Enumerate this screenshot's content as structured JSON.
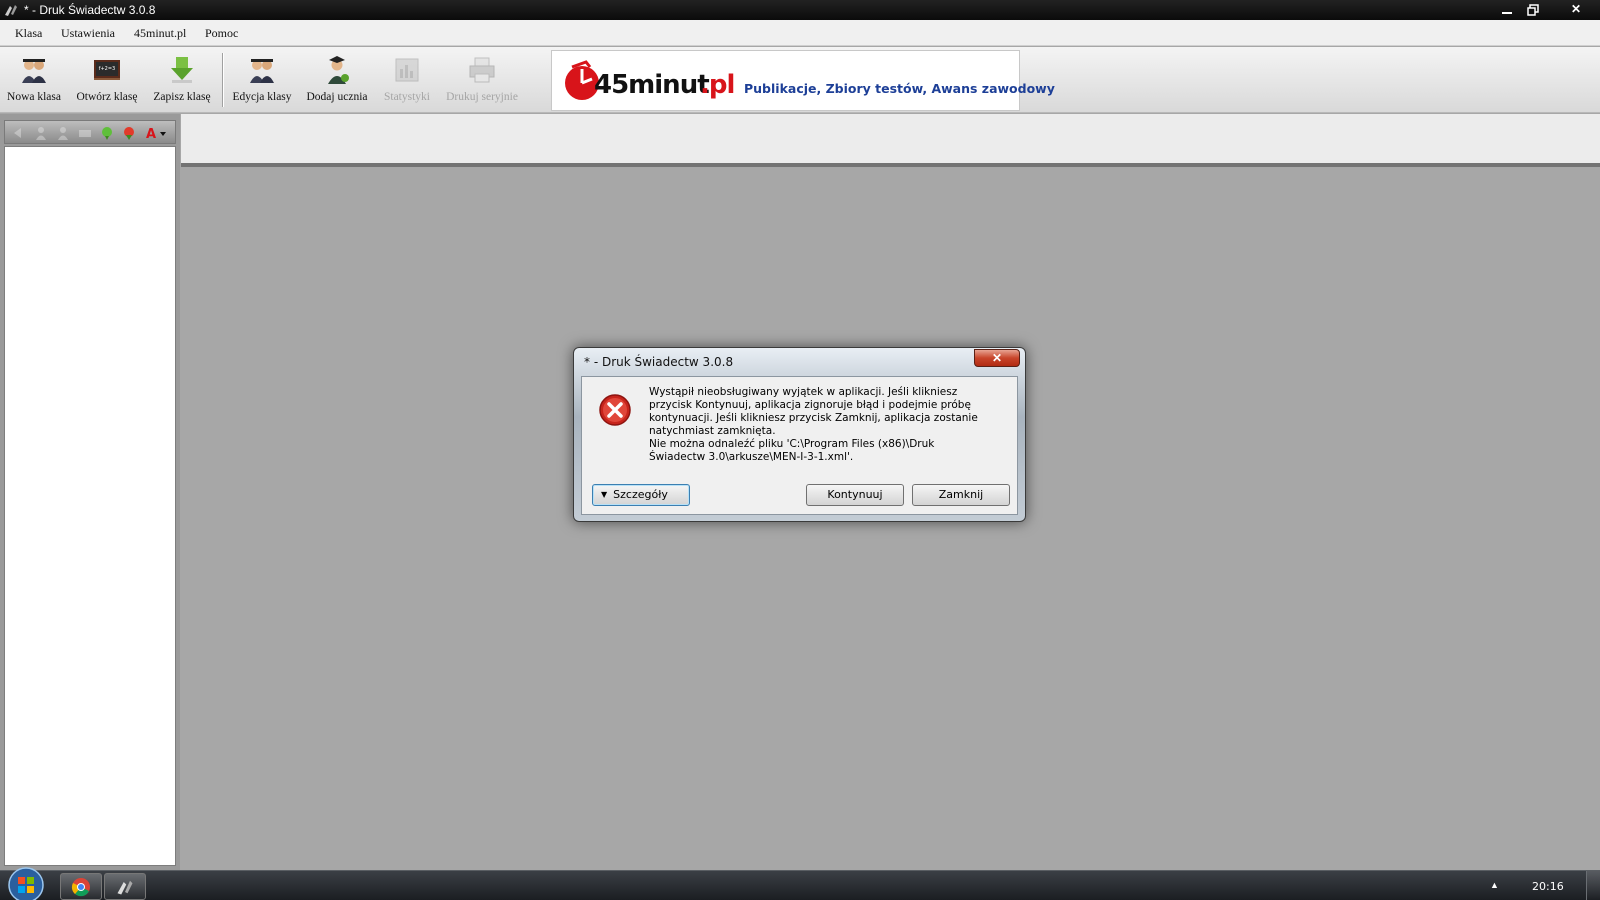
{
  "window": {
    "title": "* - Druk Świadectw 3.0.8",
    "minimize": "🗕",
    "maximize": "🗗",
    "close": "✕"
  },
  "menu": [
    "Klasa",
    "Ustawienia",
    "45minut.pl",
    "Pomoc"
  ],
  "toolbar": {
    "tools": [
      {
        "label": "Nowa klasa",
        "icon": "students-group-icon",
        "enabled": true
      },
      {
        "label": "Otwórz klasę",
        "icon": "blackboard-icon",
        "enabled": true
      },
      {
        "label": "Zapisz klasę",
        "icon": "save-arrow-icon",
        "enabled": true
      },
      {
        "label": "Edycja klasy",
        "icon": "students-edit-icon",
        "enabled": true
      },
      {
        "label": "Dodaj ucznia",
        "icon": "add-student-icon",
        "enabled": true
      },
      {
        "label": "Statystyki",
        "icon": "statistics-icon",
        "enabled": false
      },
      {
        "label": "Drukuj seryjnie",
        "icon": "printer-icon",
        "enabled": false
      }
    ]
  },
  "banner": {
    "logo_text": "45minut.pl",
    "tagline": "Publikacje, Zbiory testów, Awans zawodowy",
    "colors": {
      "logo_red": "#d8141a",
      "tagline_blue": "#1d3f97"
    }
  },
  "clock": "20:16",
  "dialog": {
    "title": "* - Druk Świadectw 3.0.8",
    "close": "✕",
    "message_line1": "Wystąpił nieobsługiwany wyjątek w aplikacji. Jeśli klikniesz przycisk Kontynuuj, aplikacja zignoruje błąd i podejmie próbę kontynuacji. Jeśli klikniesz przycisk Zamknij, aplikacja zostanie natychmiast zamknięta.",
    "message_line2": "Nie można odnaleźć pliku 'C:\\Program Files (x86)\\Druk Świadectw 3.0\\arkusze\\MEN-I-3-1.xml'.",
    "buttons": {
      "details": "Szczegóły",
      "continue": "Kontynuuj",
      "close": "Zamknij"
    }
  }
}
